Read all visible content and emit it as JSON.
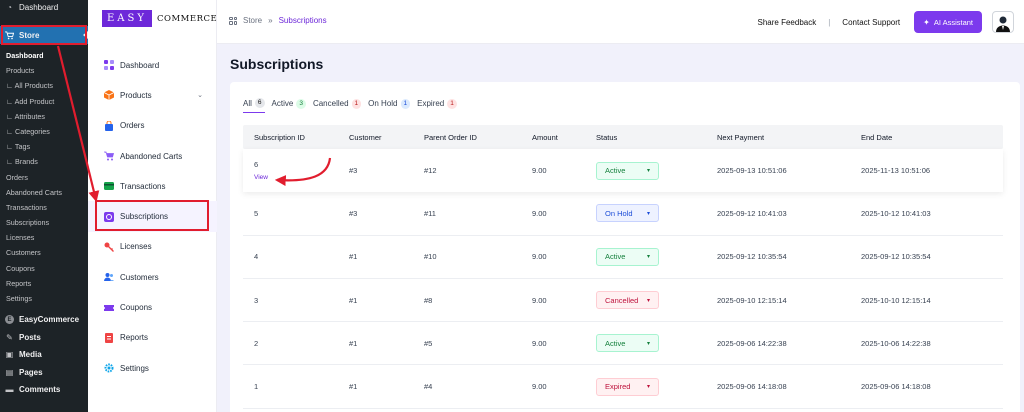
{
  "wp_menu": {
    "dashboard": "Dashboard",
    "store": "Store",
    "submenu": [
      "Dashboard",
      "Products",
      "∟ All Products",
      "∟ Add Product",
      "∟ Attributes",
      "∟ Categories",
      "∟ Tags",
      "∟ Brands",
      "Orders",
      "Abandoned Carts",
      "Transactions",
      "Subscriptions",
      "Licenses",
      "Customers",
      "Coupons",
      "Reports",
      "Settings"
    ],
    "easycommerce": "EasyCommerce",
    "posts": "Posts",
    "media": "Media",
    "pages": "Pages",
    "comments": "Comments"
  },
  "logo": {
    "box": "EASY",
    "text": "COMMERCE"
  },
  "ec_nav": [
    {
      "label": "Dashboard",
      "icon": "dashboard-icon",
      "color": "#7c3aed"
    },
    {
      "label": "Products",
      "icon": "box-icon",
      "color": "#f97316"
    },
    {
      "label": "Orders",
      "icon": "bag-icon",
      "color": "#2563eb"
    },
    {
      "label": "Abandoned Carts",
      "icon": "cart-icon",
      "color": "#8b5cf6"
    },
    {
      "label": "Transactions",
      "icon": "transaction-icon",
      "color": "#16a34a"
    },
    {
      "label": "Subscriptions",
      "icon": "subscription-icon",
      "color": "#7c3aed"
    },
    {
      "label": "Licenses",
      "icon": "key-icon",
      "color": "#ef4444"
    },
    {
      "label": "Customers",
      "icon": "users-icon",
      "color": "#2563eb"
    },
    {
      "label": "Coupons",
      "icon": "coupon-icon",
      "color": "#7c3aed"
    },
    {
      "label": "Reports",
      "icon": "report-icon",
      "color": "#ef4444"
    },
    {
      "label": "Settings",
      "icon": "gear-icon",
      "color": "#0ea5e9"
    }
  ],
  "header": {
    "crumb_root": "Store",
    "crumb_sep": "»",
    "crumb_current": "Subscriptions",
    "share_feedback": "Share Feedback",
    "divider": "|",
    "contact_support": "Contact Support",
    "ai_assistant": "AI Assistant"
  },
  "page_title": "Subscriptions",
  "tabs": [
    {
      "label": "All",
      "count": "6"
    },
    {
      "label": "Active",
      "count": "3"
    },
    {
      "label": "Cancelled",
      "count": "1"
    },
    {
      "label": "On Hold",
      "count": "1"
    },
    {
      "label": "Expired",
      "count": "1"
    }
  ],
  "columns": [
    "Subscription ID",
    "Customer",
    "Parent Order ID",
    "Amount",
    "Status",
    "Next Payment",
    "End Date"
  ],
  "view_label": "View",
  "rows": [
    {
      "id": "6",
      "customer": "#3",
      "order": "#12",
      "amount": "9.00",
      "status": "Active",
      "next": "2025-09-13 10:51:06",
      "end": "2025-11-13 10:51:06"
    },
    {
      "id": "5",
      "customer": "#3",
      "order": "#11",
      "amount": "9.00",
      "status": "On Hold",
      "next": "2025-09-12 10:41:03",
      "end": "2025-10-12 10:41:03"
    },
    {
      "id": "4",
      "customer": "#1",
      "order": "#10",
      "amount": "9.00",
      "status": "Active",
      "next": "2025-09-12 10:35:54",
      "end": "2025-09-12 10:35:54"
    },
    {
      "id": "3",
      "customer": "#1",
      "order": "#8",
      "amount": "9.00",
      "status": "Cancelled",
      "next": "2025-09-10 12:15:14",
      "end": "2025-10-10 12:15:14"
    },
    {
      "id": "2",
      "customer": "#1",
      "order": "#5",
      "amount": "9.00",
      "status": "Active",
      "next": "2025-09-06 14:22:38",
      "end": "2025-10-06 14:22:38"
    },
    {
      "id": "1",
      "customer": "#1",
      "order": "#4",
      "amount": "9.00",
      "status": "Expired",
      "next": "2025-09-06 14:18:08",
      "end": "2025-09-06 14:18:08"
    }
  ],
  "colors": {
    "accent": "#6d28d9",
    "annotation": "#e11d2e",
    "wp_active": "#2271b1"
  }
}
